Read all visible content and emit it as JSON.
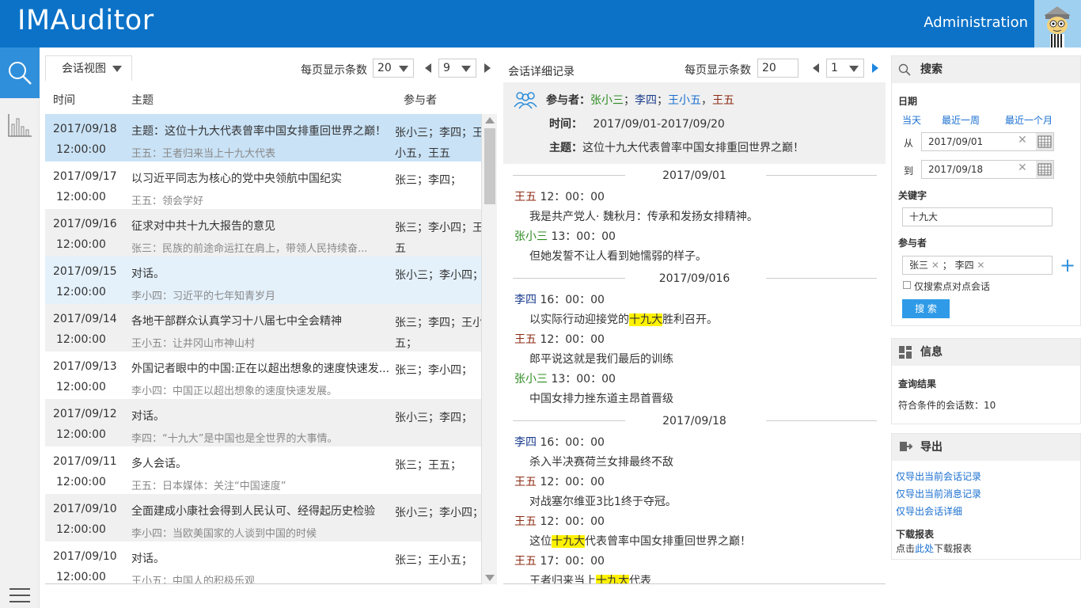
{
  "app": {
    "title": "IMAuditor",
    "admin_label": "Administration"
  },
  "list": {
    "view_label": "会话视图",
    "per_page_label": "每页显示条数",
    "per_page_value": "20",
    "page_value": "9",
    "headers": {
      "time": "时间",
      "subject": "主题",
      "participants": "参与者"
    },
    "rows": [
      {
        "date": "2017/09/18",
        "time": "12:00:00",
        "subject": "主题：这位十九大代表曾率中国女排重回世界之巅！",
        "sub": "王五：王者归来当上十九大代表",
        "parts": "张小三；李四；王小五，王五"
      },
      {
        "date": "2017/09/17",
        "time": "12:00:00",
        "subject": "以习近平同志为核心的党中央领航中国纪实",
        "sub": "王五：领会学好",
        "parts": "张三；李四；"
      },
      {
        "date": "2017/09/16",
        "time": "12:00:00",
        "subject": "征求对中共十九大报告的意见",
        "sub": "张三：民族的前途命运扛在肩上，带领人民持续奋...",
        "parts": "张三；李小四；王五"
      },
      {
        "date": "2017/09/15",
        "time": "12:00:00",
        "subject": "对话。",
        "sub": "李小四：习近平的七年知青岁月",
        "parts": "张小三；李小四；"
      },
      {
        "date": "2017/09/14",
        "time": "12:00:00",
        "subject": "各地干部群众认真学习十八届七中全会精神",
        "sub": "王小五：让井冈山市神山村",
        "parts": "张三；李四；王小五；"
      },
      {
        "date": "2017/09/13",
        "time": "12:00:00",
        "subject": "外国记者眼中的中国:正在以超出想象的速度快速发...",
        "sub": "李小四：中国正以超出想象的速度快速发展。",
        "parts": "张三；李小四；"
      },
      {
        "date": "2017/09/12",
        "time": "12:00:00",
        "subject": "对话。",
        "sub": "李四：“十九大”是中国也是全世界的大事情。",
        "parts": "张小三；李四；"
      },
      {
        "date": "2017/09/11",
        "time": "12:00:00",
        "subject": "多人会话。",
        "sub": "王五：日本媒体：关注“中国速度”",
        "parts": "张三；王五；"
      },
      {
        "date": "2017/09/10",
        "time": "12:00:00",
        "subject": "全面建成小康社会得到人民认可、经得起历史检验",
        "sub": "李小四：当欧美国家的人谈到中国的时候",
        "parts": "张小三；李小四；"
      },
      {
        "date": "2017/09/10",
        "time": "12:00:00",
        "subject": "对话。",
        "sub": "王小五：中国人的积极乐观",
        "parts": "张三；王小五；"
      }
    ]
  },
  "detail": {
    "title": "会话详细记录",
    "per_page_label": "每页显示条数",
    "per_page_value": "20",
    "page_value": "1",
    "participants_label": "参与者：",
    "participants": [
      {
        "name": "张小三",
        "color": "#2e8b22"
      },
      {
        "name": "李四",
        "color": "#1a3c8c"
      },
      {
        "name": "王小五",
        "color": "#1a6fd0"
      },
      {
        "name": "王五",
        "color": "#8b2a12"
      }
    ],
    "time_label": "时间：",
    "time_value": "2017/09/01-2017/09/20",
    "subject_label": "主题：",
    "subject_value": "这位十九大代表曾率中国女排重回世界之巅！",
    "groups": [
      {
        "date": "2017/09/01",
        "messages": [
          {
            "sender": "王五",
            "color": "#8b2a12",
            "time": "12：00：00",
            "pre": "我是共产党人· 魏秋月：传承和发扬女排精神。",
            "mark": "",
            "post": ""
          },
          {
            "sender": "张小三",
            "color": "#2e8b22",
            "time": "13：00：00",
            "pre": "但她发誓不让人看到她懦弱的样子。",
            "mark": "",
            "post": ""
          }
        ]
      },
      {
        "date": "2017/09/016",
        "messages": [
          {
            "sender": "李四",
            "color": "#1a3c8c",
            "time": "16：00：00",
            "pre": "以实际行动迎接党的",
            "mark": "十九大",
            "post": "胜利召开。"
          },
          {
            "sender": "王五",
            "color": "#8b2a12",
            "time": "12：00：00",
            "pre": "郎平说这就是我们最后的训练",
            "mark": "",
            "post": ""
          },
          {
            "sender": "张小三",
            "color": "#2e8b22",
            "time": "13：00：00",
            "pre": "中国女排力挫东道主昂首晋级",
            "mark": "",
            "post": ""
          }
        ]
      },
      {
        "date": "2017/09/18",
        "messages": [
          {
            "sender": "李四",
            "color": "#1a3c8c",
            "time": "16：00：00",
            "pre": "杀入半决赛荷兰女排最终不敌",
            "mark": "",
            "post": ""
          },
          {
            "sender": "王五",
            "color": "#8b2a12",
            "time": "12：00：00",
            "pre": "对战塞尔维亚3比1终于夺冠。",
            "mark": "",
            "post": ""
          },
          {
            "sender": "王五",
            "color": "#8b2a12",
            "time": "12：00：00",
            "pre": "这位",
            "mark": "十九大",
            "post": "代表曾率中国女排重回世界之巅！"
          },
          {
            "sender": "王五",
            "color": "#8b2a12",
            "time": "17：00：00",
            "pre": "王者归来当上",
            "mark": "十九大",
            "post": "代表"
          }
        ]
      }
    ]
  },
  "search": {
    "title": "搜索",
    "date_label": "日期",
    "quick": [
      "当天",
      "最近一周",
      "最近一个月"
    ],
    "from_label": "从",
    "from_value": "2017/09/01",
    "to_label": "到",
    "to_value": "2017/09/18",
    "keyword_label": "关键字",
    "keyword_value": "十九大",
    "participants_label": "参与者",
    "participants_tokens": [
      "张三",
      "李四"
    ],
    "p2p_only_label": "仅搜索点对点会话",
    "search_button": "搜 索"
  },
  "info": {
    "title": "信息",
    "result_label": "查询结果",
    "count_text": "符合条件的会话数：10"
  },
  "export": {
    "title": "导出",
    "links": [
      "仅导出当前会话记录",
      "仅导出当前消息记录",
      "仅导出会话详细"
    ],
    "report_label": "下载报表",
    "report_pre": "点击",
    "report_link": "此处",
    "report_post": "下载报表"
  }
}
